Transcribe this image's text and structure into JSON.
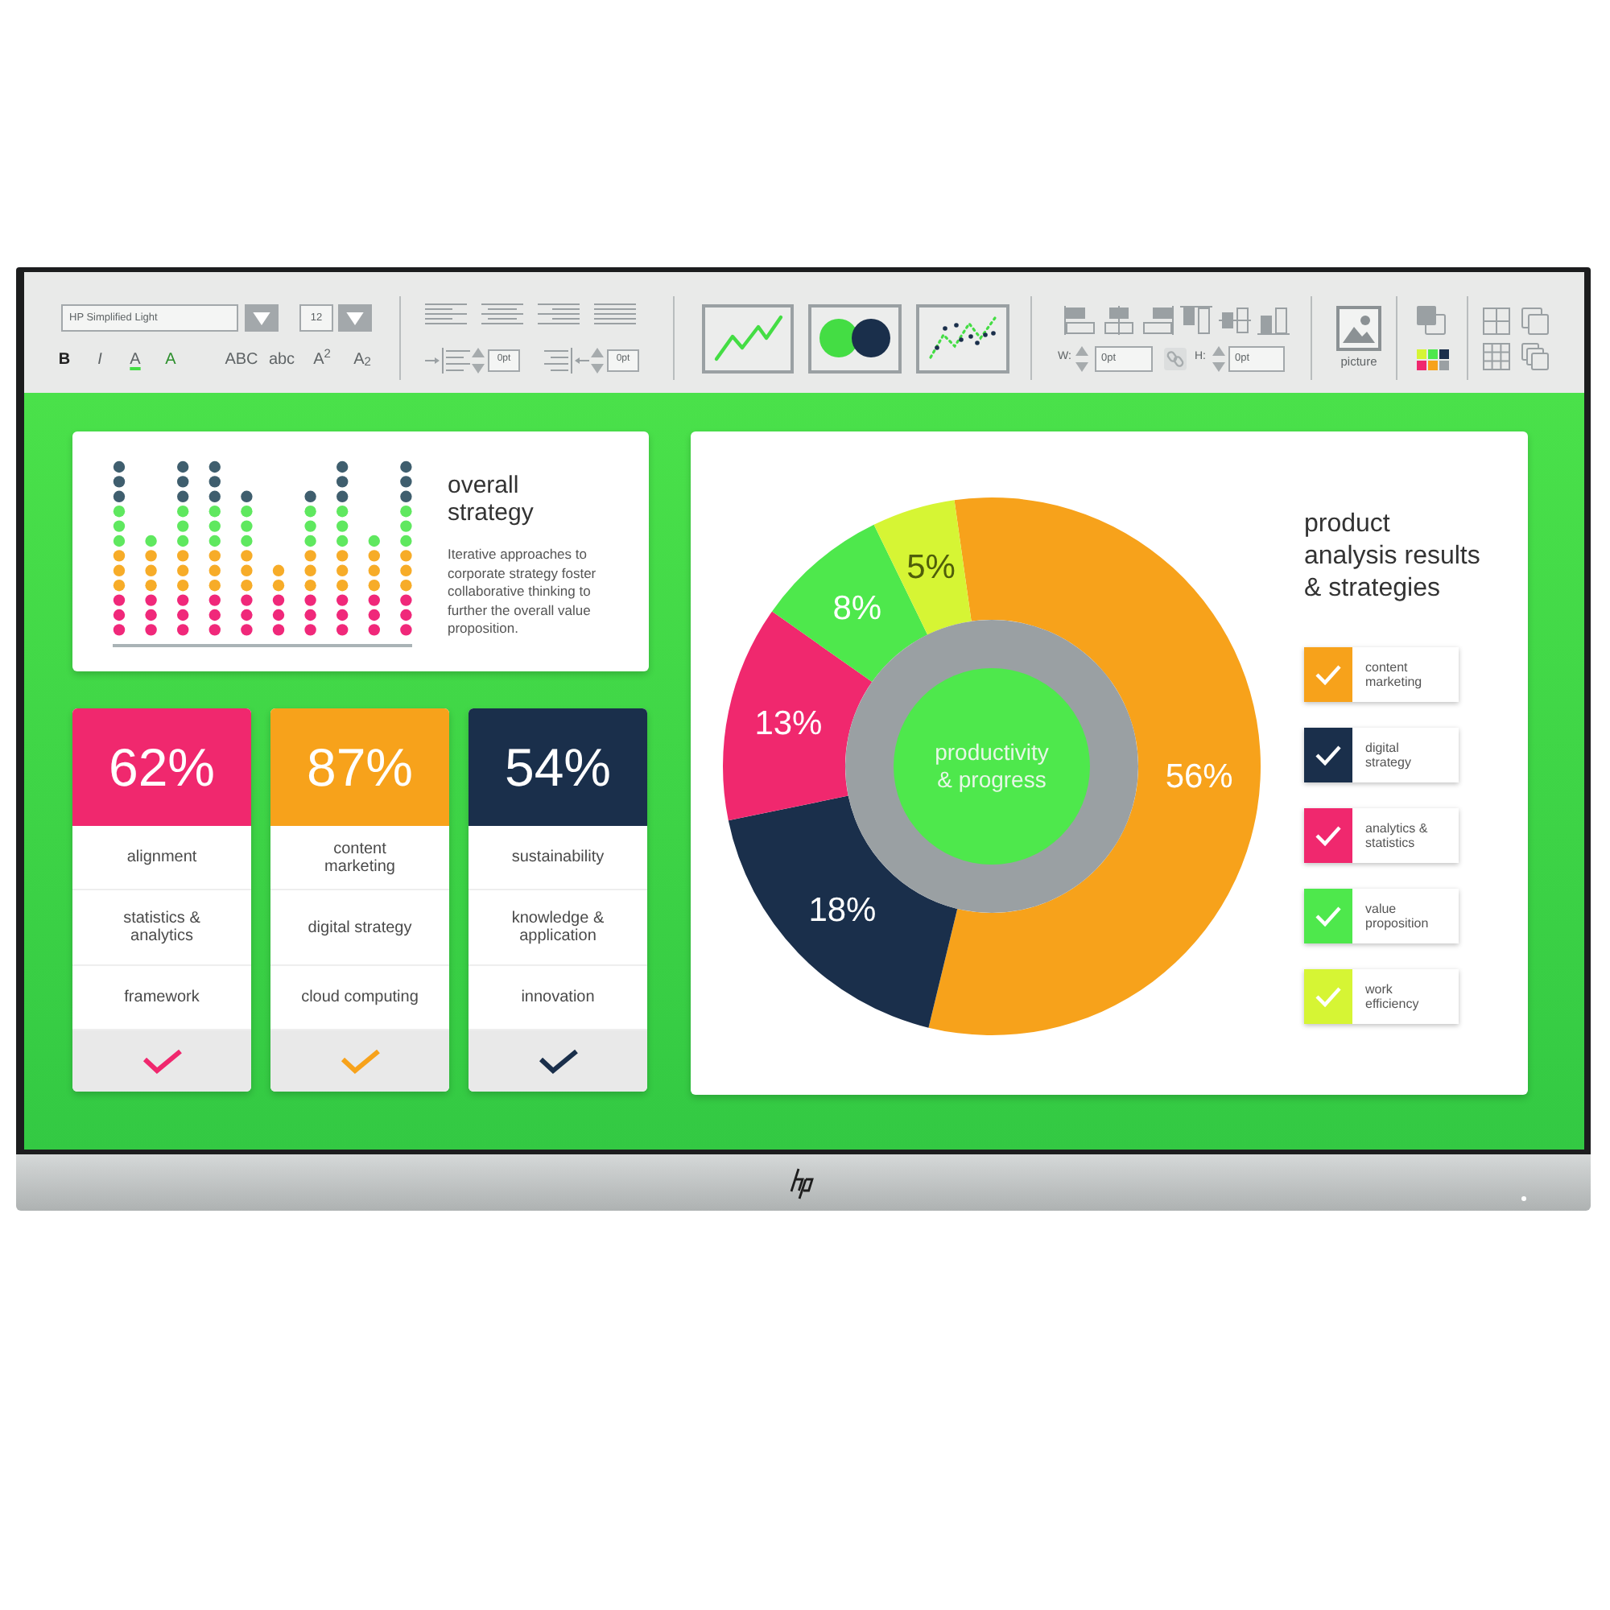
{
  "toolbar": {
    "font": {
      "value": "HP Simplified Light"
    },
    "size": {
      "value": "12"
    },
    "text_buttons": [
      {
        "label": "B",
        "kind": "bold"
      },
      {
        "label": "I",
        "kind": "italic"
      },
      {
        "label": "A",
        "kind": "font_color"
      },
      {
        "label": "A",
        "kind": "highlight"
      },
      {
        "label": "ABC",
        "kind": "uppercase"
      },
      {
        "label": "abc",
        "kind": "lowercase"
      },
      {
        "label": "A$^{2}$",
        "kind": "superscript"
      },
      {
        "label": "A$_{2}$",
        "kind": "subscript"
      }
    ],
    "indent_fields": [
      {
        "value": "0pt"
      },
      {
        "value": "0pt"
      }
    ],
    "size_fields": [
      {
        "label": "W:",
        "value": "0pt"
      },
      {
        "label": "H:",
        "value": "0pt"
      }
    ],
    "picture_button": {
      "label": "picture"
    }
  },
  "strategy_card": {
    "title": "overall strategy",
    "body": "Iterative approaches to corporate strategy foster collaborative thinking to further the overall value proposition."
  },
  "stat_cards": [
    {
      "value": "62%",
      "color": "#f0286e",
      "items": [
        "alignment",
        "statistics &\nanalytics",
        "framework"
      ]
    },
    {
      "value": "87%",
      "color": "#f7a21b",
      "items": [
        "content\nmarketing",
        "digital strategy",
        "cloud computing"
      ]
    },
    {
      "value": "54%",
      "color": "#1a2f4b",
      "items": [
        "sustainability",
        "knowledge &\napplication",
        "innovation"
      ]
    }
  ],
  "analysis_card": {
    "title": "product\nanalysis results\n& strategies",
    "chart": {
      "center_label": "productivity & progress",
      "chart_data": {
        "type": "donut",
        "values": [
          56,
          18,
          13,
          8,
          5
        ],
        "value_labels": [
          "56%",
          "18%",
          "13%",
          "8%",
          "5%"
        ]
      }
    },
    "legend": [
      {
        "label": "content\nmarketing",
        "color": "#f7a21b"
      },
      {
        "label": "digital\nstrategy",
        "color": "#1a2f4b"
      },
      {
        "label": "analytics &\nstatistics",
        "color": "#f0286e"
      },
      {
        "label": "value\nproposition",
        "color": "#4ee84c"
      },
      {
        "label": "work\nefficiency",
        "color": "#d6f534"
      }
    ]
  }
}
